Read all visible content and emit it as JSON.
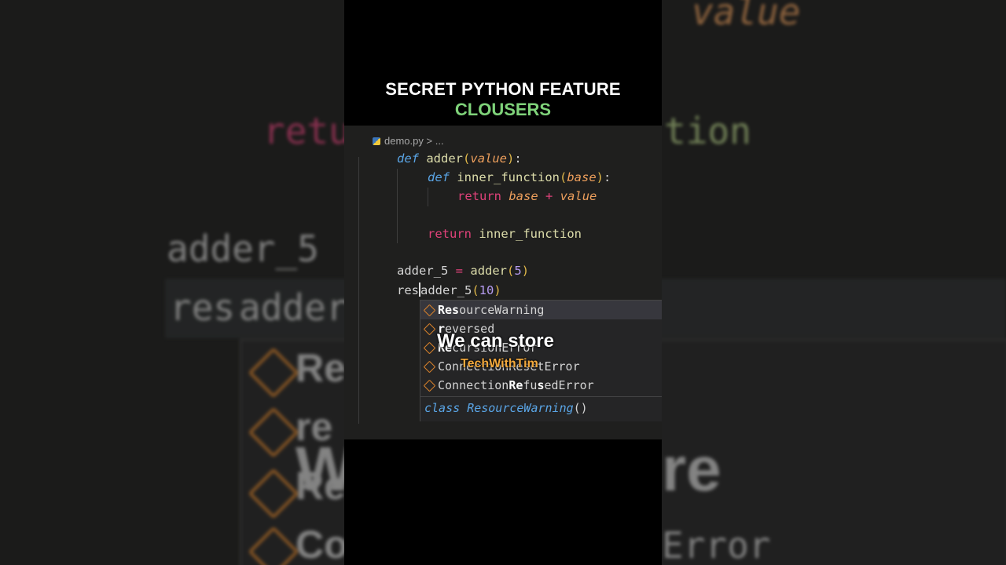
{
  "video": {
    "title_line1": "SECRET PYTHON FEATURE",
    "title_line2": "CLOUSERS",
    "caption": "We can store",
    "watermark": "TechWithTim"
  },
  "editor": {
    "breadcrumb_file": "demo.py",
    "breadcrumb_sep": ">",
    "breadcrumb_more": "...",
    "lines": {
      "l1_kw": "def",
      "l1_name": "adder",
      "l1_param": "value",
      "l2_kw": "def",
      "l2_name": "inner_function",
      "l2_param": "base",
      "l3_ret": "return",
      "l3_a": "base",
      "l3_op": "+",
      "l3_b": "value",
      "l5_ret": "return",
      "l5_name": "inner_function",
      "l7_var": "adder_5",
      "l7_op": "=",
      "l7_fn": "adder",
      "l7_num": "5",
      "l8_typed": "res",
      "l8_rest": "adder_5",
      "l8_num": "10"
    }
  },
  "suggestions": {
    "items": [
      {
        "match": "Res",
        "rest": "ourceWarning"
      },
      {
        "match": "r",
        "rest": "eversed"
      },
      {
        "match": "Re",
        "rest": "cursionError"
      },
      {
        "match": "Con",
        "rest": "nectionResetError"
      },
      {
        "pre": "Connection",
        "match": "Re",
        "mid": "fu",
        "match2": "s",
        "rest": "edError"
      }
    ],
    "detail_kw": "class",
    "detail_name": "ResourceWarning",
    "detail_sig": "()"
  },
  "background": {
    "code_top": "value",
    "code_ret": "retu",
    "code_fn": "tion",
    "code_adder": "adder_5",
    "code_res": "res",
    "code_adder2": "adder",
    "big_re": "Re",
    "big_re2": "re",
    "big_re3": "Re",
    "big_co": "Co",
    "big_w": "W",
    "big_re4": "re",
    "big_err": "Error"
  },
  "colors": {
    "accent_green": "#7fd37a",
    "keyword_blue": "#5aa5e6",
    "watermark_orange": "#f2a83b"
  }
}
